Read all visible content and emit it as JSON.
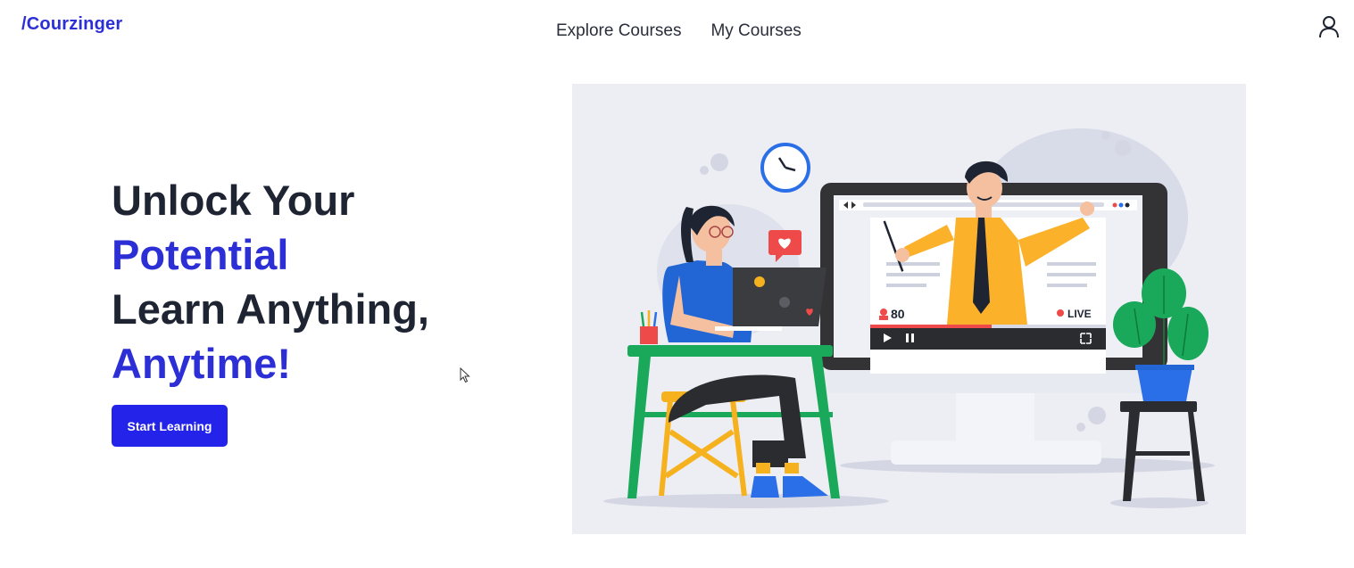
{
  "brand": {
    "logo_text": "/Courzinger"
  },
  "nav": {
    "items": [
      {
        "label": "Explore Courses"
      },
      {
        "label": "My Courses"
      }
    ]
  },
  "header": {
    "user_icon": "user-icon"
  },
  "hero": {
    "line1": "Unlock Your",
    "line2": "Potential",
    "line3": "Learn Anything,",
    "line4": "Anytime!",
    "cta_label": "Start Learning"
  },
  "illustration": {
    "viewer_count": "80",
    "live_label": "LIVE"
  },
  "colors": {
    "accent": "#2d2fd6",
    "button": "#2323ea",
    "text_dark": "#1f2433"
  }
}
